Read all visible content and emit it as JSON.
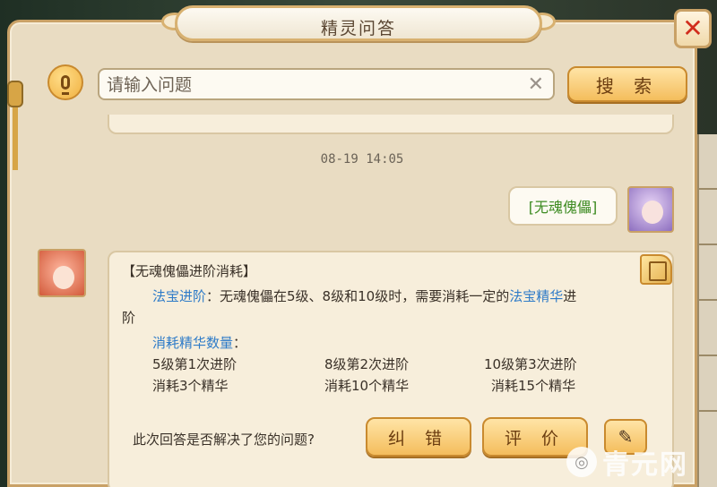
{
  "window": {
    "title": "精灵问答"
  },
  "search": {
    "placeholder": "请输入问题",
    "button_label": "搜 索"
  },
  "chat": {
    "timestamp": "08-19 14:05",
    "user_message": "[无魂傀儡]",
    "answer": {
      "title": "【无魂傀儡进阶消耗】",
      "line1_prefix": "法宝进阶",
      "line1_mid": "：无魂傀儡在5级、8级和10级时，需要消耗一定的",
      "line1_link": "法宝精华",
      "line1_suffix": "进",
      "line2": "阶",
      "sub_label": "消耗精华数量",
      "sub_colon": "：",
      "columns": [
        {
          "stage": "5级第1次进阶",
          "cost": "消耗3个精华"
        },
        {
          "stage": "8级第2次进阶",
          "cost": "消耗10个精华"
        },
        {
          "stage": "10级第3次进阶",
          "cost": "消耗15个精华"
        }
      ]
    },
    "feedback": {
      "question": "此次回答是否解决了您的问题?",
      "fix_label": "纠 错",
      "rate_label": "评 价"
    }
  },
  "watermark": {
    "text": "青元网"
  },
  "icons": {
    "mic": "microphone-icon",
    "clear": "clear-icon",
    "close": "close-icon",
    "book": "book-icon",
    "share": "edit-share-icon"
  },
  "colors": {
    "accent": "#f4bd5c",
    "link": "#2e7bc8",
    "user_text": "#3d8b22",
    "close": "#d12d1d"
  }
}
